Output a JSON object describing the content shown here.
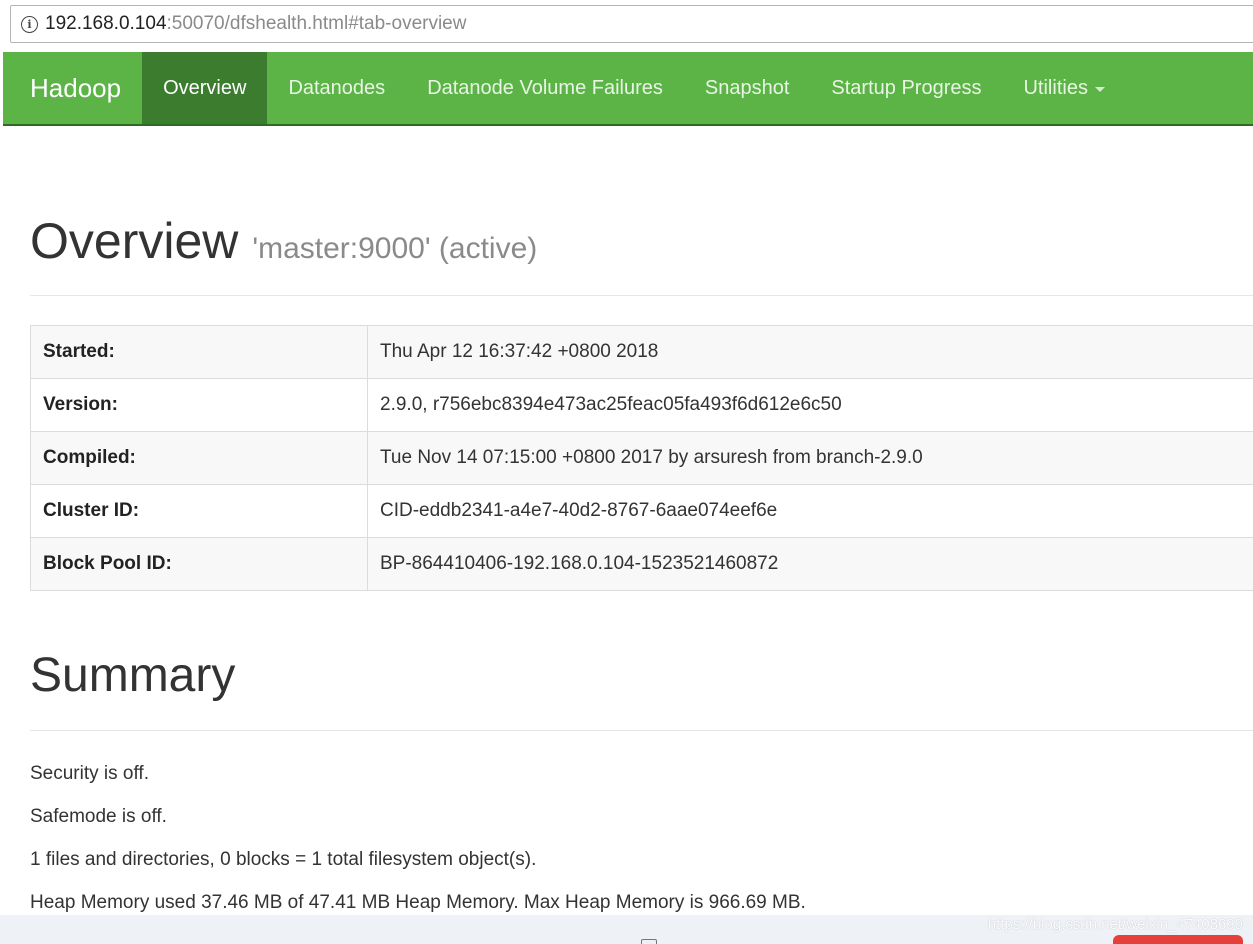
{
  "browser": {
    "url_host": "192.168.0.104",
    "url_rest": ":50070/dfshealth.html#tab-overview"
  },
  "navbar": {
    "brand": "Hadoop",
    "items": [
      {
        "label": "Overview",
        "active": true
      },
      {
        "label": "Datanodes"
      },
      {
        "label": "Datanode Volume Failures"
      },
      {
        "label": "Snapshot"
      },
      {
        "label": "Startup Progress"
      },
      {
        "label": "Utilities"
      }
    ]
  },
  "overview": {
    "title": "Overview",
    "subtitle": "'master:9000' (active)",
    "rows": [
      {
        "key": "Started:",
        "value": "Thu Apr 12 16:37:42 +0800 2018"
      },
      {
        "key": "Version:",
        "value": "2.9.0, r756ebc8394e473ac25feac05fa493f6d612e6c50"
      },
      {
        "key": "Compiled:",
        "value": "Tue Nov 14 07:15:00 +0800 2017 by arsuresh from branch-2.9.0"
      },
      {
        "key": "Cluster ID:",
        "value": "CID-eddb2341-a4e7-40d2-8767-6aae074eef6e"
      },
      {
        "key": "Block Pool ID:",
        "value": "BP-864410406-192.168.0.104-1523521460872"
      }
    ]
  },
  "summary": {
    "title": "Summary",
    "lines": [
      "Security is off.",
      "Safemode is off.",
      "1 files and directories, 0 blocks = 1 total filesystem object(s).",
      "Heap Memory used 37.46 MB of 47.41 MB Heap Memory. Max Heap Memory is 966.69 MB."
    ]
  },
  "watermark": "https://blog.csdn.net/weixin_47408699",
  "colors": {
    "navbar": "#5cb447",
    "navbar_active": "#3c7c2e"
  }
}
